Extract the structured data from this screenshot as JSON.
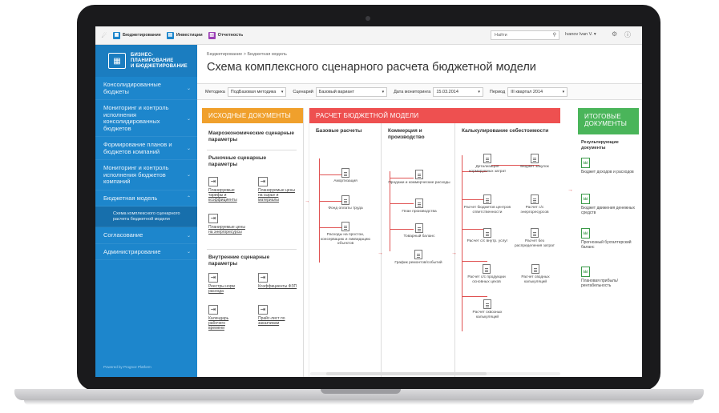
{
  "topbar": {
    "tabs": [
      {
        "label": "Бюджетирование",
        "color": "#1d86cc"
      },
      {
        "label": "Инвестиции",
        "color": "#1d86cc"
      },
      {
        "label": "Отчетность",
        "color": "#9b3fb5"
      }
    ],
    "search_placeholder": "Найти",
    "user": "Ivanov Ivan V. ▾"
  },
  "sidebar": {
    "brand": [
      "БИЗНЕС-",
      "ПЛАНИРОВАНИЕ",
      "И БЮДЖЕТИРОВАНИЕ"
    ],
    "items": [
      "Консолидированные бюджеты",
      "Мониторинг и контроль исполнения консолидированных бюджетов",
      "Формирование планов и бюджетов компаний",
      "Мониторинг и контроль исполнения бюджетов компаний",
      "Бюджетная модель",
      "Схема комплексного сценарного расчета бюджетной модели",
      "Согласование",
      "Администрирование"
    ],
    "powered": "Powered by Prognoz Platform"
  },
  "header": {
    "breadcrumb": "Бюджетирование  >  Бюджетная модель",
    "title": "Схема комплексного сценарного расчета бюджетной модели"
  },
  "filters": {
    "method_label": "Методика",
    "method_value": "ПодБазовая методика",
    "scenario_label": "Сценарий",
    "scenario_value": "Базовый вариант",
    "date_label": "Дата мониторинга",
    "date_value": "15.03.2014",
    "period_label": "Период",
    "period_value": "III квартал 2014"
  },
  "left_panel": {
    "header": "ИСХОДНЫЕ ДОКУМЕНТЫ",
    "macro": "Макроэкономические сценарные параметры",
    "market": "Рыночные сценарные параметры",
    "market_items": [
      "Планируемые тарифы и коэффициенты",
      "Планируемые цены на сырье и материалы",
      "Планируемые цены на энергоресурсы"
    ],
    "internal": "Внутренние сценарные параметры",
    "internal_items": [
      "Реестры норм расхода",
      "Коэффициенты ФЗП",
      "Календарь рабочего времени",
      "Прайс-лист по заказчикам"
    ]
  },
  "mid_panel": {
    "header": "РАСЧЕТ БЮДЖЕТНОЙ МОДЕЛИ",
    "col1": {
      "title": "Базовые расчеты",
      "nodes": [
        "Амортизация",
        "Фонд оплаты труда",
        "Расходы на простои, консервацию и ликвидацию объектов"
      ]
    },
    "col2": {
      "title": "Коммерция и производство",
      "nodes": [
        "Продажи и коммерческие расходы",
        "План производства",
        "Товарный баланс",
        "График ремонтов/событий"
      ]
    },
    "col3": {
      "title": "Калькулирование себестоимости",
      "nodes": [
        "Детализация нормируемых затрат",
        "Бюджет закупок",
        "Расчет бюджетов центров ответственности",
        "Расчет с/с энергоресурсов",
        "Расчет с/с внутр. услуг",
        "Расчет без распределения затрат",
        "Расчет с/с продукции основных цехов",
        "Расчет сводных калькуляций",
        "Расчет сквозных калькуляций"
      ]
    }
  },
  "right_panel": {
    "header": "ИТОГОВЫЕ ДОКУМЕНТЫ",
    "subtitle": "Результирующие документы",
    "items": [
      "Бюджет доходов и расходов",
      "Бюджет движения денежных средств",
      "Прогнозный бухгалтерский баланс",
      "Плановая прибыль/ рентабельность"
    ]
  }
}
